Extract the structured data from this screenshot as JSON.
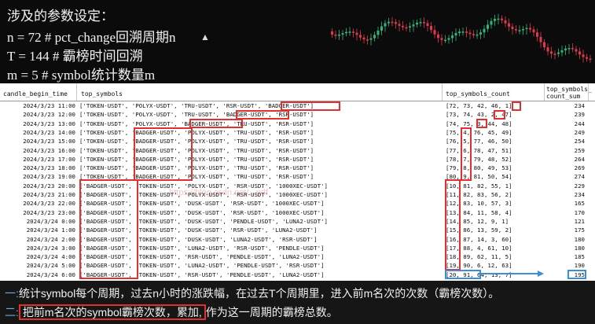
{
  "params": {
    "line1": "n = 72  # pct_change回溯周期n",
    "line2": "T = 144  # 霸榜时间回溯",
    "line3": "m = 5  # symbol统计数量m"
  },
  "watermark": "https://blog.csdn.net/...pdf",
  "table": {
    "columns": {
      "time": "candle_begin_time",
      "symbols": "top_symbols",
      "count": "top_symbols_count",
      "sum_line1": "top_symbols_",
      "sum_line2": "count_sum"
    },
    "rows": [
      {
        "time": "2024/3/23 11:00",
        "symbols": "['TOKEN-USDT', 'POLYX-USDT', 'TRU-USDT', 'RSR-USDT', 'BADGER-USDT']",
        "count": "[72, 73, 42, 46, 1]",
        "sum": "234"
      },
      {
        "time": "2024/3/23 12:00",
        "symbols": "['TOKEN-USDT', 'POLYX-USDT', 'TRU-USDT', 'BADGER-USDT', 'RSR-USDT']",
        "count": "[73, 74, 43, 2, 47]",
        "sum": "239"
      },
      {
        "time": "2024/3/23 13:00",
        "symbols": "['TOKEN-USDT', 'POLYX-USDT', 'BADGER-USDT', 'TRU-USDT', 'RSR-USDT']",
        "count": "[74, 75, 3, 44, 48]",
        "sum": "244"
      },
      {
        "time": "2024/3/23 14:00",
        "symbols": "['TOKEN-USDT', 'BADGER-USDT', 'POLYX-USDT', 'TRU-USDT', 'RSR-USDT']",
        "count": "[75, 4, 76, 45, 49]",
        "sum": "249"
      },
      {
        "time": "2024/3/23 15:00",
        "symbols": "['TOKEN-USDT', 'BADGER-USDT', 'POLYX-USDT', 'TRU-USDT', 'RSR-USDT']",
        "count": "[76, 5, 77, 46, 50]",
        "sum": "254"
      },
      {
        "time": "2024/3/23 16:00",
        "symbols": "['TOKEN-USDT', 'BADGER-USDT', 'POLYX-USDT', 'TRU-USDT', 'RSR-USDT']",
        "count": "[77, 6, 78, 47, 51]",
        "sum": "259"
      },
      {
        "time": "2024/3/23 17:00",
        "symbols": "['TOKEN-USDT', 'BADGER-USDT', 'POLYX-USDT', 'TRU-USDT', 'RSR-USDT']",
        "count": "[78, 7, 79, 48, 52]",
        "sum": "264"
      },
      {
        "time": "2024/3/23 18:00",
        "symbols": "['TOKEN-USDT', 'BADGER-USDT', 'POLYX-USDT', 'TRU-USDT', 'RSR-USDT']",
        "count": "[79, 8, 80, 49, 53]",
        "sum": "269"
      },
      {
        "time": "2024/3/23 19:00",
        "symbols": "['TOKEN-USDT', 'BADGER-USDT', 'POLYX-USDT', 'TRU-USDT', 'RSR-USDT']",
        "count": "[80, 9, 81, 50, 54]",
        "sum": "274"
      },
      {
        "time": "2024/3/23 20:00",
        "symbols": "['BADGER-USDT', 'TOKEN-USDT', 'POLYX-USDT', 'RSR-USDT', '1000XEC-USDT']",
        "count": "[10, 81, 82, 55, 1]",
        "sum": "229"
      },
      {
        "time": "2024/3/23 21:00",
        "symbols": "['BADGER-USDT', 'TOKEN-USDT', 'POLYX-USDT', 'RSR-USDT', '1000XEC-USDT']",
        "count": "[11, 82, 83, 56, 2]",
        "sum": "234"
      },
      {
        "time": "2024/3/23 22:00",
        "symbols": "['BADGER-USDT', 'TOKEN-USDT', 'DUSK-USDT', 'RSR-USDT', '1000XEC-USDT']",
        "count": "[12, 83, 10, 57, 3]",
        "sum": "165"
      },
      {
        "time": "2024/3/23 23:00",
        "symbols": "['BADGER-USDT', 'TOKEN-USDT', 'DUSK-USDT', 'RSR-USDT', '1000XEC-USDT']",
        "count": "[13, 84, 11, 58, 4]",
        "sum": "170"
      },
      {
        "time": "2024/3/24 0:00",
        "symbols": "['BADGER-USDT', 'TOKEN-USDT', 'DUSK-USDT', 'PENDLE-USDT', 'LUNA2-USDT']",
        "count": "[14, 85, 12, 9, 1]",
        "sum": "121"
      },
      {
        "time": "2024/3/24 1:00",
        "symbols": "['BADGER-USDT', 'TOKEN-USDT', 'DUSK-USDT', 'RSR-USDT', 'LUNA2-USDT']",
        "count": "[15, 86, 13, 59, 2]",
        "sum": "175"
      },
      {
        "time": "2024/3/24 2:00",
        "symbols": "['BADGER-USDT', 'TOKEN-USDT', 'DUSK-USDT', 'LUNA2-USDT', 'RSR-USDT']",
        "count": "[16, 87, 14, 3, 60]",
        "sum": "180"
      },
      {
        "time": "2024/3/24 3:00",
        "symbols": "['BADGER-USDT', 'TOKEN-USDT', 'LUNA2-USDT', 'RSR-USDT', 'PENDLE-USDT']",
        "count": "[17, 88, 4, 61, 10]",
        "sum": "180"
      },
      {
        "time": "2024/3/24 4:00",
        "symbols": "['BADGER-USDT', 'TOKEN-USDT', 'RSR-USDT', 'PENDLE-USDT', 'LUNA2-USDT']",
        "count": "[18, 89, 62, 11, 5]",
        "sum": "185"
      },
      {
        "time": "2024/3/24 5:00",
        "symbols": "['BADGER-USDT', 'TOKEN-USDT', 'LUNA2-USDT', 'PENDLE-USDT', 'RSR-USDT']",
        "count": "[19, 90, 6, 12, 63]",
        "sum": "190"
      },
      {
        "time": "2024/3/24 6:00",
        "symbols": "['BADGER-USDT', 'TOKEN-USDT', 'RSR-USDT', 'PENDLE-USDT', 'LUNA2-USDT']",
        "count": "[20, 91, 64, 13, 7]",
        "sum": "195"
      }
    ]
  },
  "notes": {
    "n1_badge": "一:",
    "n1_text": "统计symbol每个周期，过去n小时的涨跌幅，在过去T个周期里，进入前m名次的次数（霸榜次数）。",
    "n2_badge": "二:",
    "n2_highlight": "把前m名次的symbol霸榜次数，累加,",
    "n2_text": "作为这一周期的霸榜总数。"
  },
  "colors": {
    "highlight_red": "#e03030",
    "highlight_blue": "#3a8fd8",
    "candle_up": "#2fb67c",
    "candle_down": "#e0394d"
  }
}
